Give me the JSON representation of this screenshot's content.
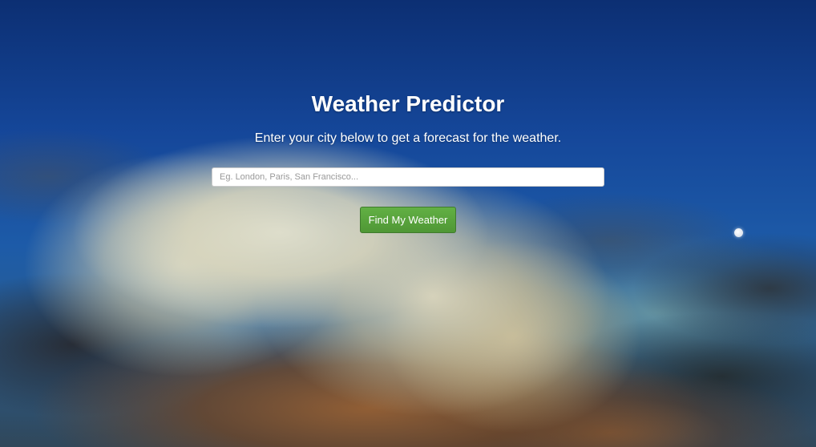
{
  "header": {
    "title": "Weather Predictor",
    "subtitle": "Enter your city below to get a forecast for the weather."
  },
  "search": {
    "value": "",
    "placeholder": "Eg. London, Paris, San Francisco..."
  },
  "actions": {
    "submit_label": "Find My Weather"
  },
  "colors": {
    "button": "#5cb85c",
    "sky": "#15479a"
  }
}
